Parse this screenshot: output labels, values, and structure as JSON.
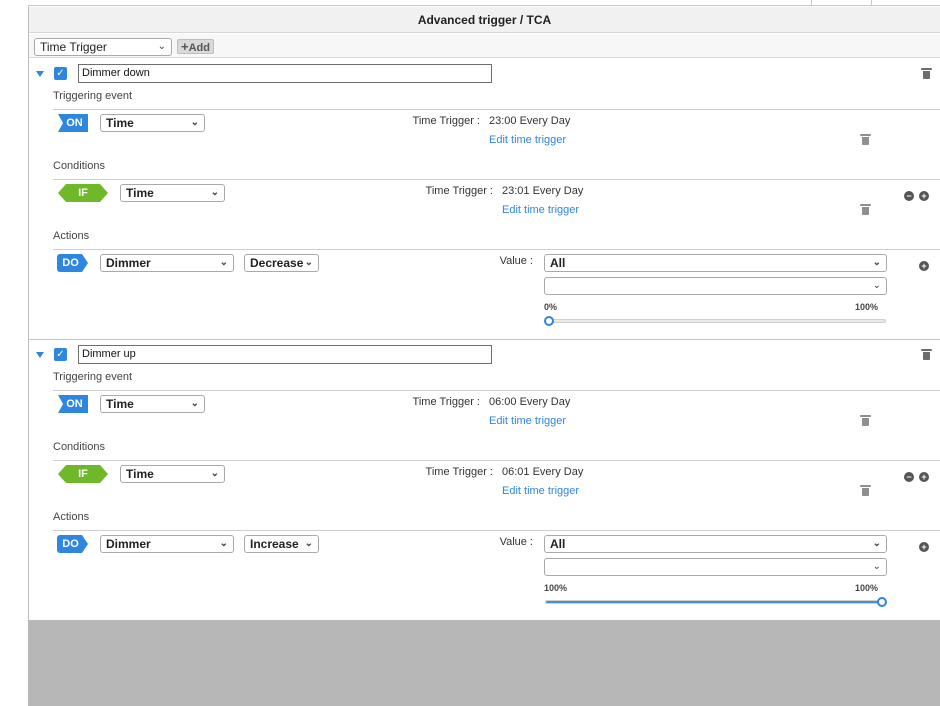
{
  "panel": {
    "title": "Advanced trigger / TCA",
    "toolbar": {
      "select_value": "Time Trigger",
      "add_label": "Add"
    }
  },
  "rules": [
    {
      "name": "Dimmer down",
      "enabled": true,
      "trigger": {
        "section_label": "Triggering event",
        "badge": "ON",
        "type": "Time",
        "kv_label": "Time Trigger :",
        "kv_value": "23:00 Every Day",
        "link": "Edit time trigger"
      },
      "condition": {
        "section_label": "Conditions",
        "badge": "IF",
        "type": "Time",
        "kv_label": "Time Trigger :",
        "kv_value": "23:01 Every Day",
        "link": "Edit time trigger"
      },
      "action": {
        "section_label": "Actions",
        "badge": "DO",
        "device": "Dimmer",
        "operation": "Decrease",
        "value_label": "Value :",
        "value_select": "All",
        "value_select2": "",
        "slider_left": "0%",
        "slider_right": "100%",
        "slider_value": 0
      }
    },
    {
      "name": "Dimmer up",
      "enabled": true,
      "trigger": {
        "section_label": "Triggering event",
        "badge": "ON",
        "type": "Time",
        "kv_label": "Time Trigger :",
        "kv_value": "06:00 Every Day",
        "link": "Edit time trigger"
      },
      "condition": {
        "section_label": "Conditions",
        "badge": "IF",
        "type": "Time",
        "kv_label": "Time Trigger :",
        "kv_value": "06:01 Every Day",
        "link": "Edit time trigger"
      },
      "action": {
        "section_label": "Actions",
        "badge": "DO",
        "device": "Dimmer",
        "operation": "Increase",
        "value_label": "Value :",
        "value_select": "All",
        "value_select2": "",
        "slider_left": "100%",
        "slider_right": "100%",
        "slider_value": 1
      }
    }
  ],
  "colors": {
    "accent_blue": "#2e86de",
    "if_green": "#6fb829",
    "link_blue": "#2e86de",
    "footer_gray": "#b7b7b7"
  },
  "icons": {
    "collapse": "caret-down-icon",
    "checkbox": "checkbox-checked-icon",
    "delete": "trash-icon",
    "remove": "minus-circle-icon",
    "add": "plus-circle-icon",
    "dropdown": "chevron-down-icon"
  }
}
